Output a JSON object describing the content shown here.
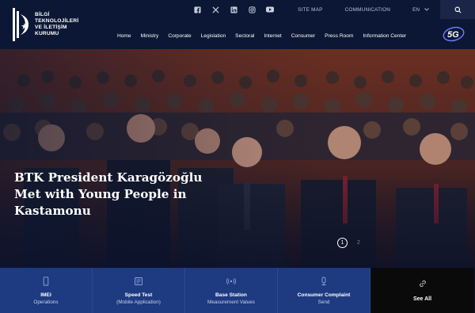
{
  "brand": {
    "lines": [
      "BİLGİ",
      "TEKNOLOJİLERİ",
      "VE İLETİŞİM",
      "KURUMU"
    ]
  },
  "topbar": {
    "social": [
      "facebook-icon",
      "x-icon",
      "linkedin-icon",
      "instagram-icon",
      "youtube-icon"
    ],
    "site_map": "SITE MAP",
    "communication": "COMMUNICATION",
    "language": "EN"
  },
  "nav": {
    "items": [
      "Home",
      "Ministry",
      "Corporate",
      "Legislation",
      "Sectoral",
      "Internet",
      "Consumer",
      "Press Room",
      "Information Center"
    ]
  },
  "badge": {
    "label": "5G"
  },
  "hero": {
    "title": "BTK President Karagözoğlu Met with Young People in Kastamonu",
    "pager": [
      "1",
      "2"
    ]
  },
  "cards": [
    {
      "icon": "phone-icon",
      "title": "IMEI",
      "subtitle": "Operations"
    },
    {
      "icon": "speedtest-icon",
      "title": "Speed Test",
      "subtitle": "(Mobile Application)"
    },
    {
      "icon": "antenna-icon",
      "title": "Base Station",
      "subtitle": "Measurement Values"
    },
    {
      "icon": "complaint-icon",
      "title": "Consumer Complaint",
      "subtitle": "Send"
    }
  ],
  "see_all": {
    "icon": "link-icon",
    "label": "See All"
  },
  "colors": {
    "header_bg": "#0b1734",
    "card_bg": "#1e3a80",
    "see_all_bg": "#0a0a0a"
  }
}
